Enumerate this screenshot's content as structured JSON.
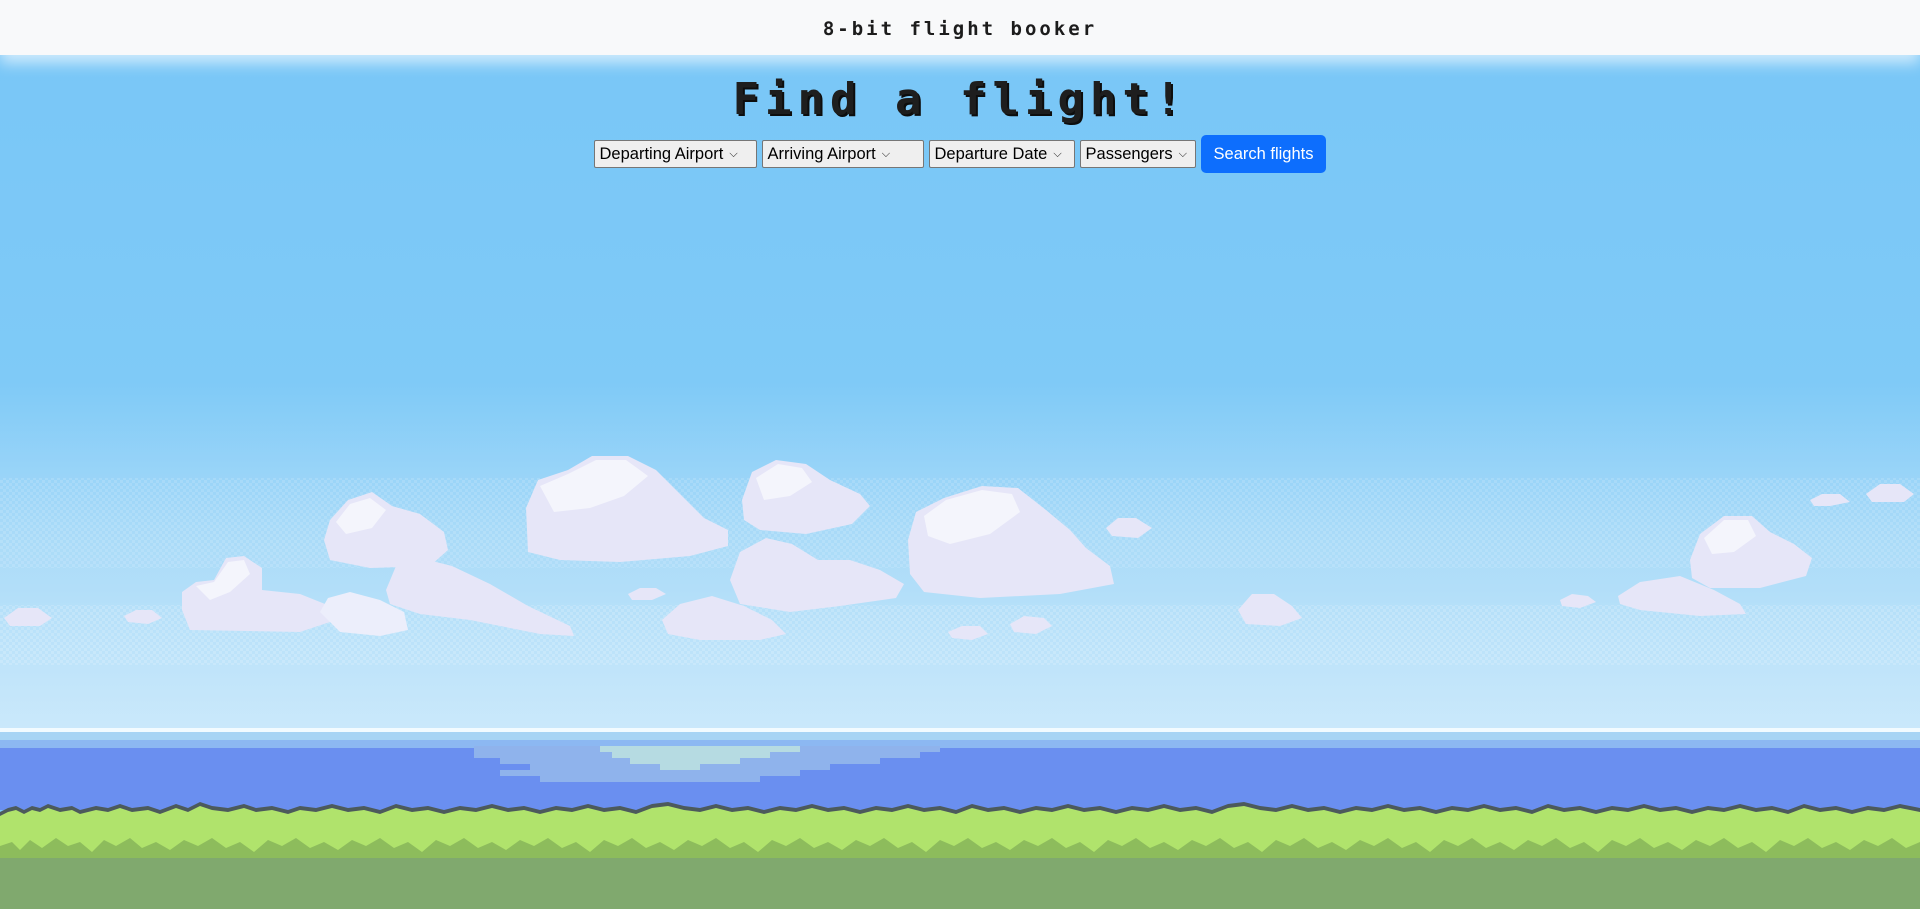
{
  "navbar": {
    "brand": "8-bit flight booker"
  },
  "hero": {
    "title": "Find a flight!"
  },
  "form": {
    "departing": "Departing Airport",
    "arriving": "Arriving Airport",
    "date": "Departure Date",
    "passengers": "Passengers",
    "submit": "Search flights"
  },
  "icons": {
    "dropdown": "chevron-down-icon"
  },
  "colors": {
    "sky": "#7ac7f7",
    "navbar": "#f8f9fa",
    "button": "#0d6efd",
    "sea": "#6a8ff0",
    "grass_light": "#b0e36c",
    "grass_dark": "#80a96e"
  }
}
